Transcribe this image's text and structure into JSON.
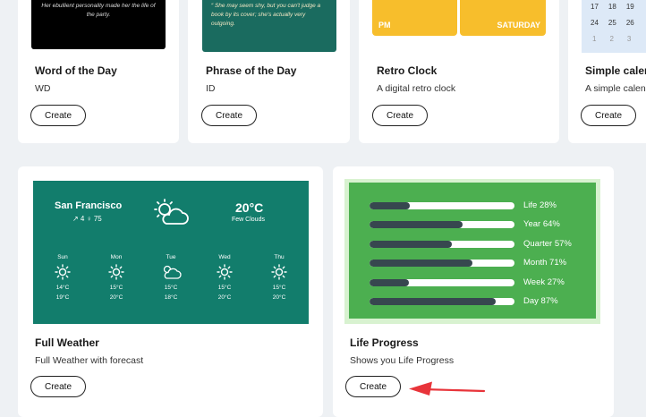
{
  "cards_top": [
    {
      "title": "Word of the Day",
      "desc": "WD",
      "thumb_text": "Her ebullient personality made her the life of the party.",
      "button": "Create"
    },
    {
      "title": "Phrase of the Day",
      "desc": "ID",
      "thumb_text": "“ She may seem shy, but you can't judge a book by its cover; she's actually very outgoing.",
      "button": "Create"
    },
    {
      "title": "Retro Clock",
      "desc": "A digital retro clock",
      "clock_left": "PM",
      "clock_right": "SATURDAY",
      "button": "Create"
    },
    {
      "title": "Simple calen",
      "desc": "A simple calen",
      "button": "Create",
      "calendar_rows": [
        [
          "17",
          "18",
          "19"
        ],
        [
          "24",
          "25",
          "26"
        ],
        [
          "1",
          "2",
          "3"
        ]
      ]
    }
  ],
  "weather_card": {
    "title": "Full Weather",
    "desc": "Full Weather with forecast",
    "button": "Create",
    "city": "San Francisco",
    "sub": "↗ 4  ♀ 75",
    "temp": "20°C",
    "condition": "Few Clouds",
    "days": [
      {
        "day": "Sun",
        "icon": "sun-icon",
        "low": "14°C",
        "high": "19°C"
      },
      {
        "day": "Mon",
        "icon": "sun-icon",
        "low": "15°C",
        "high": "20°C"
      },
      {
        "day": "Tue",
        "icon": "cloud-icon",
        "low": "15°C",
        "high": "18°C"
      },
      {
        "day": "Wed",
        "icon": "sun-icon",
        "low": "15°C",
        "high": "20°C"
      },
      {
        "day": "Thu",
        "icon": "sun-icon",
        "low": "15°C",
        "high": "20°C"
      }
    ]
  },
  "life_card": {
    "title": "Life Progress",
    "desc": "Shows you Life Progress",
    "button": "Create",
    "rows": [
      {
        "label": "Life 28%",
        "percent": 28
      },
      {
        "label": "Year 64%",
        "percent": 64
      },
      {
        "label": "Quarter 57%",
        "percent": 57
      },
      {
        "label": "Month 71%",
        "percent": 71
      },
      {
        "label": "Week 27%",
        "percent": 27
      },
      {
        "label": "Day 87%",
        "percent": 87
      }
    ]
  },
  "colors": {
    "weather_bg": "#127d6c",
    "life_green": "#4caf50",
    "life_bar": "#37474f",
    "clock_yellow": "#f7be2c",
    "arrow_red": "#e8343a"
  }
}
